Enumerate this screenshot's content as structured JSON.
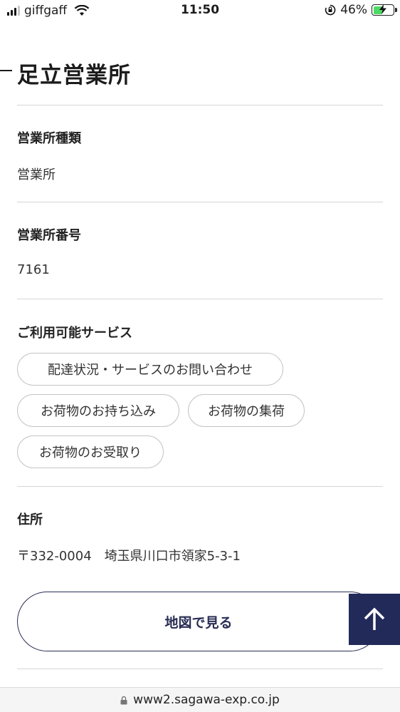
{
  "status_bar": {
    "carrier": "giffgaff",
    "time": "11:50",
    "battery_percent": "46%",
    "battery_level": 0.46,
    "icons": [
      "signal-icon",
      "wifi-icon",
      "rotation-lock-icon",
      "battery-charging-icon"
    ]
  },
  "office": {
    "title": "足立営業所"
  },
  "sections": {
    "type": {
      "label": "営業所種類",
      "value": "営業所"
    },
    "number": {
      "label": "営業所番号",
      "value": "7161"
    },
    "services": {
      "label": "ご利用可能サービス",
      "items": [
        "配達状況・サービスのお問い合わせ",
        "お荷物のお持ち込み",
        "お荷物の集荷",
        "お荷物のお受取り"
      ]
    },
    "address": {
      "label": "住所",
      "value": "〒332-0004　埼玉県川口市領家5-3-1"
    }
  },
  "actions": {
    "map_button": "地図で見る",
    "back_to_top_icon": "arrow-up-icon"
  },
  "browser": {
    "url": "www2.sagawa-exp.co.jp",
    "lock_icon": "padlock-icon"
  },
  "colors": {
    "accent_navy": "#222a5a",
    "battery_green": "#4cd964"
  }
}
